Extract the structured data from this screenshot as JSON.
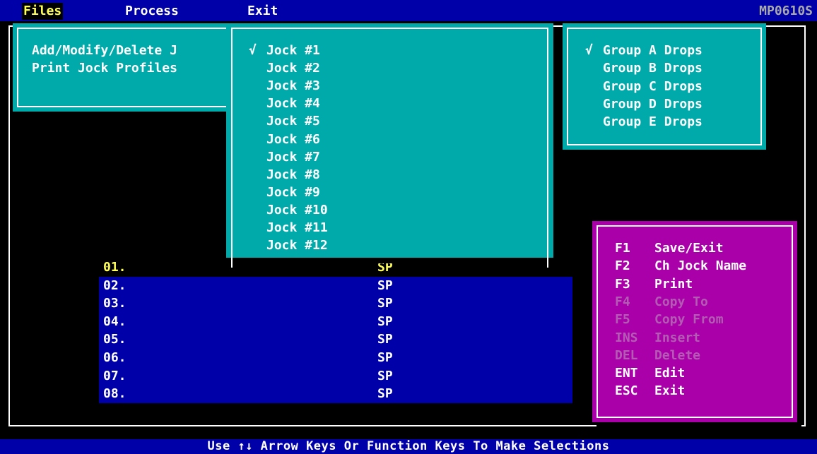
{
  "menubar": {
    "files": "Files",
    "process": "Process",
    "exit": "Exit",
    "program_code": "MP0610S"
  },
  "files_menu": {
    "items": [
      "Add/Modify/Delete J",
      "Print Jock Profiles"
    ]
  },
  "jock_menu": {
    "check_mark": "√",
    "selected_index": 0,
    "items": [
      "Jock #1",
      "Jock #2",
      "Jock #3",
      "Jock #4",
      "Jock #5",
      "Jock #6",
      "Jock #7",
      "Jock #8",
      "Jock #9",
      "Jock #10",
      "Jock #11",
      "Jock #12"
    ]
  },
  "group_menu": {
    "check_mark": "√",
    "selected_index": 0,
    "items": [
      "Group A Drops",
      "Group B Drops",
      "Group C Drops",
      "Group D Drops",
      "Group E Drops"
    ]
  },
  "rows": [
    {
      "num": "01.",
      "code": "SP"
    },
    {
      "num": "02.",
      "code": "SP"
    },
    {
      "num": "03.",
      "code": "SP"
    },
    {
      "num": "04.",
      "code": "SP"
    },
    {
      "num": "05.",
      "code": "SP"
    },
    {
      "num": "06.",
      "code": "SP"
    },
    {
      "num": "07.",
      "code": "SP"
    },
    {
      "num": "08.",
      "code": "SP"
    }
  ],
  "keys": [
    {
      "key": "F1",
      "label": "Save/Exit",
      "enabled": true
    },
    {
      "key": "F2",
      "label": "Ch Jock Name",
      "enabled": true
    },
    {
      "key": "F3",
      "label": "Print",
      "enabled": true
    },
    {
      "key": "F4",
      "label": "Copy To",
      "enabled": false
    },
    {
      "key": "F5",
      "label": "Copy From",
      "enabled": false
    },
    {
      "key": "INS",
      "label": "Insert",
      "enabled": false
    },
    {
      "key": "DEL",
      "label": "Delete",
      "enabled": false
    },
    {
      "key": "ENT",
      "label": "Edit",
      "enabled": true
    },
    {
      "key": "ESC",
      "label": "Exit",
      "enabled": true
    }
  ],
  "status": "Use ↑↓ Arrow Keys Or Function Keys To Make Selections",
  "colors": {
    "background": "#000000",
    "menubar": "#0000a8",
    "popup": "#00aaaa",
    "key_panel": "#aa00aa",
    "highlight": "#ffff55"
  }
}
